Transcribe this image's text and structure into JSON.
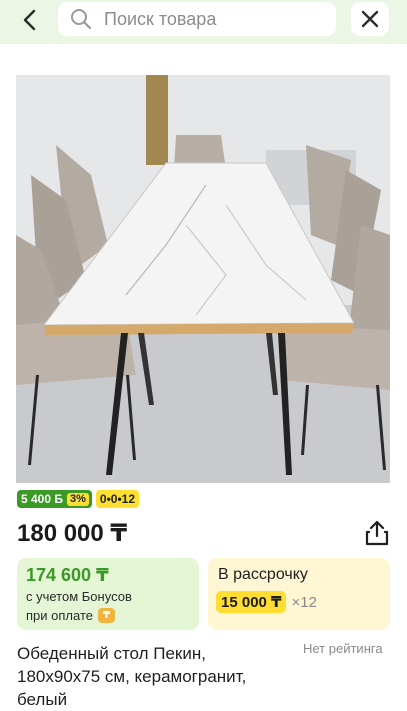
{
  "header": {
    "back_icon": "chevron-left-icon",
    "search_placeholder": "Поиск товара",
    "close_icon": "close-icon"
  },
  "product": {
    "photo_alt": "Обеденный стол Пекин",
    "bonus_badge": {
      "amount": "5 400 Б",
      "percent": "3%"
    },
    "installment_badge": "0•0•12",
    "price": "180 000 ₸",
    "bonus_offer": {
      "amount": "174 600 ₸",
      "line1": "с учетом Бонусов",
      "line2": "при оплате"
    },
    "installment_offer": {
      "title": "В рассрочку",
      "monthly": "15 000 ₸",
      "term": "×12"
    },
    "rating": "Нет рейтинга",
    "title_line1": "Обеденный стол Пекин,",
    "title_line2": "180x90x75 см, керамогранит,",
    "title_line3": "белый"
  },
  "colors": {
    "header_bg": "#ecf6e4",
    "bonus_green": "#3a9a24",
    "bonus_card_bg": "#e4f6d6",
    "installment_yellow": "#ffdd33",
    "installment_card_bg": "#fff6d3"
  }
}
